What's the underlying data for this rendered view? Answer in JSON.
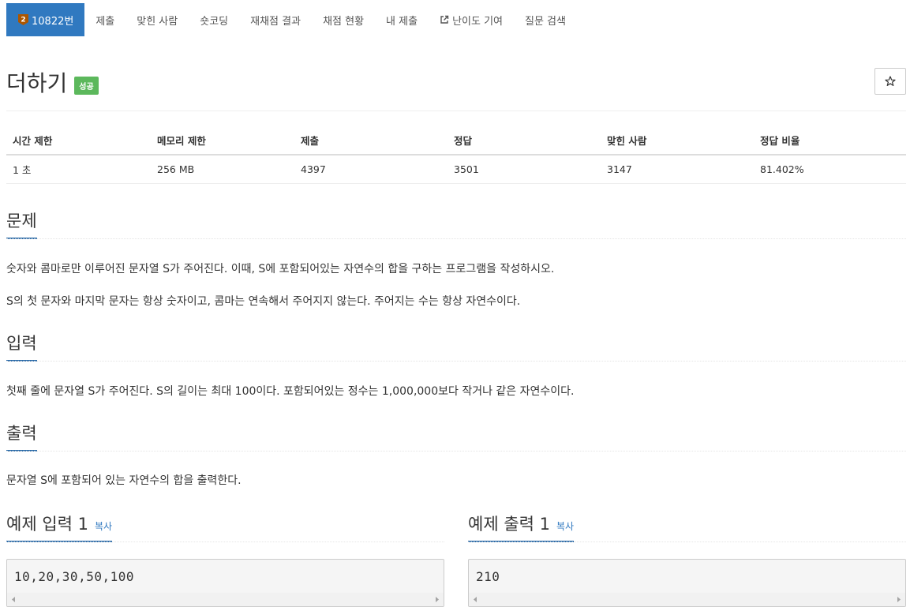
{
  "nav": {
    "problem_number": "10822번",
    "items": [
      "제출",
      "맞힌 사람",
      "숏코딩",
      "재채점 결과",
      "채점 현황",
      "내 제출",
      "난이도 기여",
      "질문 검색"
    ],
    "tier_badge_text": "2",
    "tier_color": "#ad5600",
    "active_color": "#3079c0"
  },
  "problem": {
    "title": "더하기",
    "result_badge": "성공",
    "star_icon": "☆"
  },
  "info_table": {
    "headers": [
      "시간 제한",
      "메모리 제한",
      "제출",
      "정답",
      "맞힌 사람",
      "정답 비율"
    ],
    "values": [
      "1 초",
      "256 MB",
      "4397",
      "3501",
      "3147",
      "81.402%"
    ]
  },
  "sections": {
    "description": {
      "title": "문제",
      "paragraphs": [
        "숫자와 콤마로만 이루어진 문자열 S가 주어진다. 이때, S에 포함되어있는 자연수의 합을 구하는 프로그램을 작성하시오.",
        "S의 첫 문자와 마지막 문자는 항상 숫자이고, 콤마는 연속해서 주어지지 않는다. 주어지는 수는 항상 자연수이다."
      ]
    },
    "input": {
      "title": "입력",
      "paragraphs": [
        "첫째 줄에 문자열 S가 주어진다. S의 길이는 최대 100이다. 포함되어있는 정수는 1,000,000보다 작거나 같은 자연수이다."
      ]
    },
    "output": {
      "title": "출력",
      "paragraphs": [
        "문자열 S에 포함되어 있는 자연수의 합을 출력한다."
      ]
    }
  },
  "samples": {
    "input": {
      "title": "예제 입력 1",
      "copy_label": "복사",
      "content": "10,20,30,50,100"
    },
    "output": {
      "title": "예제 출력 1",
      "copy_label": "복사",
      "content": "210"
    }
  }
}
